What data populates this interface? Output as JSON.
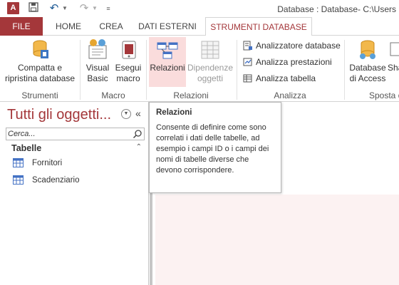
{
  "titlebar": {
    "app_icon_label": "A",
    "title": "Database : Database- C:\\Users"
  },
  "tabs": [
    {
      "label": "FILE"
    },
    {
      "label": "HOME"
    },
    {
      "label": "CREA"
    },
    {
      "label": "DATI ESTERNI"
    },
    {
      "label": "STRUMENTI DATABASE"
    }
  ],
  "ribbon": {
    "compatta": {
      "line1": "Compatta e",
      "line2": "ripristina database"
    },
    "strumenti_label": "Strumenti",
    "visual_basic": {
      "line1": "Visual",
      "line2": "Basic"
    },
    "esegui_macro": {
      "line1": "Esegui",
      "line2": "macro"
    },
    "macro_label": "Macro",
    "relazioni": {
      "label": "Relazioni"
    },
    "dipendenze": {
      "line1": "Dipendenze",
      "line2": "oggetti"
    },
    "relazioni_group_label": "Relazioni",
    "analizzatore": "Analizzatore database",
    "analizza_prestazioni": "Analizza prestazioni",
    "analizza_tabella": "Analizza tabella",
    "analizza_label": "Analizza",
    "database_access": {
      "line1": "Database",
      "line2": "di Access"
    },
    "sharepoint_cut": "Sha",
    "sposta_label": "Sposta d"
  },
  "nav": {
    "title": "Tutti gli oggetti...",
    "search_placeholder": "Cerca...",
    "group_label": "Tabelle",
    "items": [
      {
        "label": "Fornitori"
      },
      {
        "label": "Scadenziario"
      }
    ]
  },
  "tooltip": {
    "title": "Relazioni",
    "body": "Consente di definire come sono correlati i dati delle tabelle, ad esempio i campi ID o i campi dei nomi di tabelle diverse che devono corrispondere."
  },
  "colors": {
    "accent": "#a4373a",
    "highlight": "#fadcdc"
  }
}
